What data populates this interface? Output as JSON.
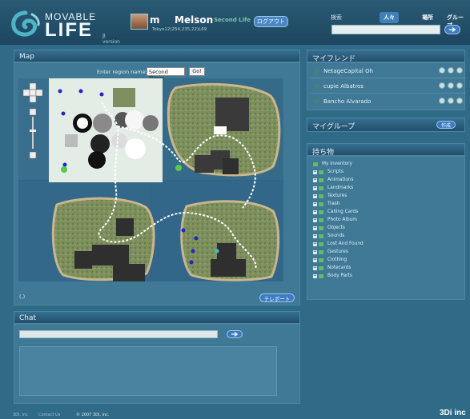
{
  "brand": {
    "line1": "MOVABLE",
    "line2": "LIFE",
    "version": "β version",
    "company": "3Di inc"
  },
  "user": {
    "first_name": "m",
    "last_name": "Melson",
    "badge": "Second Life",
    "logout": "ログアウト",
    "location": "Tokyo12(254,235,22)L69"
  },
  "search": {
    "label": "検索",
    "tabs": [
      "人々",
      "場所",
      "グループ"
    ],
    "query": ""
  },
  "map": {
    "title": "Map",
    "region_label": "Enter region name:",
    "region_value": "Second Times",
    "go_label": "Go!",
    "coords": "(,)",
    "teleport_label": "テレポート"
  },
  "chat": {
    "title": "Chat",
    "message": ""
  },
  "friends": {
    "title": "マイフレンド",
    "items": [
      {
        "name": "NetageCapital Oh"
      },
      {
        "name": "cupie Albatros"
      },
      {
        "name": "Bancho Alvarado"
      }
    ]
  },
  "groups": {
    "title": "マイグループ",
    "create_label": "作成"
  },
  "inventory": {
    "title": "持ち物",
    "root": "My Inventory",
    "folders": [
      "Scripts",
      "Animations",
      "Landmarks",
      "Textures",
      "Trash",
      "Calling Cards",
      "Photo Album",
      "Objects",
      "Sounds",
      "Lost And Found",
      "Gestures",
      "Clothing",
      "Notecards",
      "Body Parts"
    ]
  },
  "footer": {
    "link1": "3Di, inc",
    "link2": "Contact Us",
    "copyright": "© 2007 3Di, inc."
  },
  "colors": {
    "background": "#2f6a86",
    "button": "#3d7cc2",
    "panel_header": "#234f69"
  }
}
